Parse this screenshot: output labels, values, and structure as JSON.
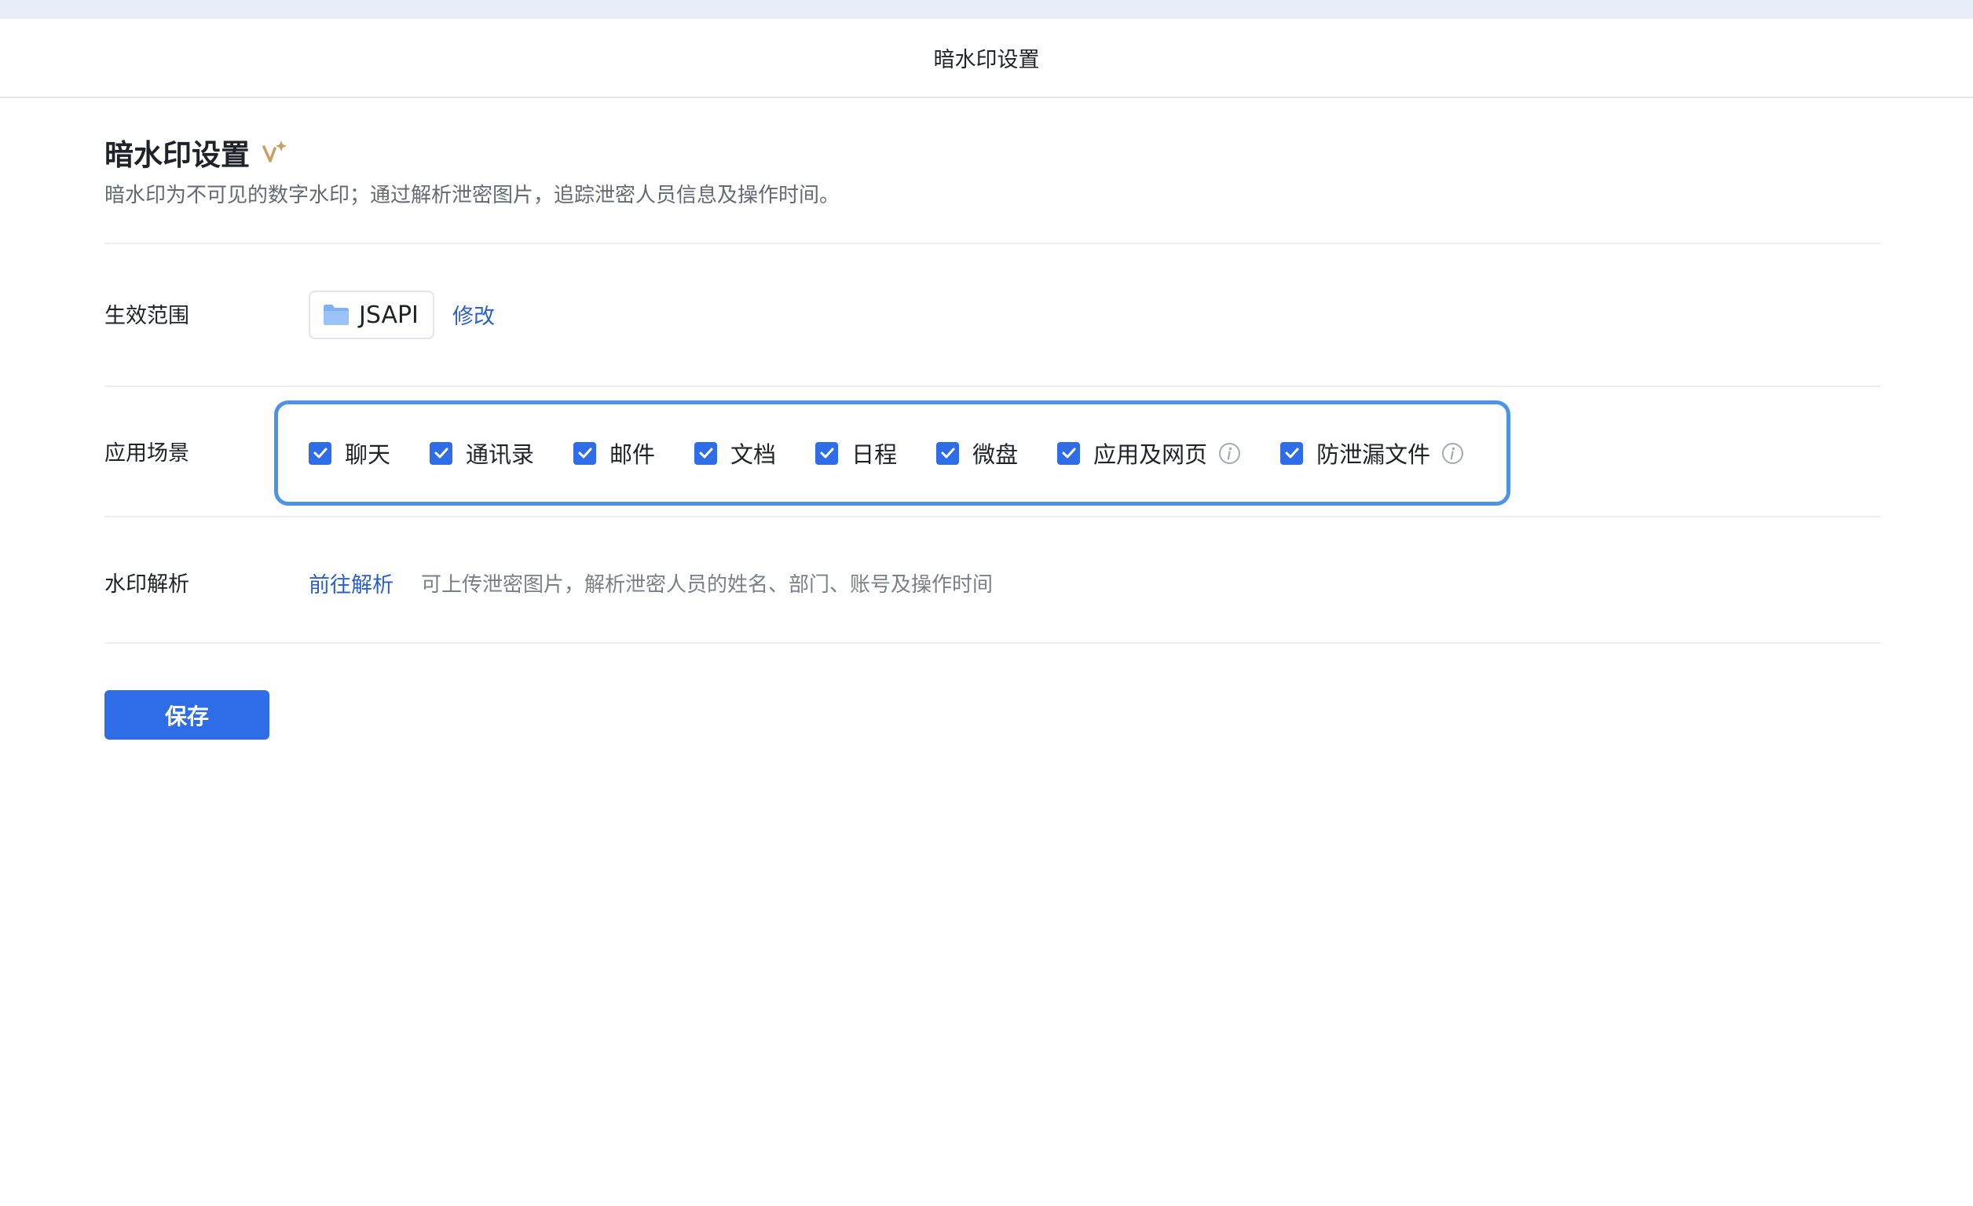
{
  "window": {
    "title": "暗水印设置"
  },
  "header": {
    "title": "暗水印设置",
    "description": "暗水印为不可见的数字水印；通过解析泄密图片，追踪泄密人员信息及操作时间。"
  },
  "scope": {
    "label": "生效范围",
    "value": "JSAPI",
    "icon": "folder-icon",
    "modify_label": "修改"
  },
  "scenes": {
    "label": "应用场景",
    "items": [
      {
        "label": "聊天",
        "checked": true,
        "info": false
      },
      {
        "label": "通讯录",
        "checked": true,
        "info": false
      },
      {
        "label": "邮件",
        "checked": true,
        "info": false
      },
      {
        "label": "文档",
        "checked": true,
        "info": false
      },
      {
        "label": "日程",
        "checked": true,
        "info": false
      },
      {
        "label": "微盘",
        "checked": true,
        "info": false
      },
      {
        "label": "应用及网页",
        "checked": true,
        "info": true
      },
      {
        "label": "防泄漏文件",
        "checked": true,
        "info": true
      }
    ]
  },
  "analysis": {
    "label": "水印解析",
    "link_label": "前往解析",
    "description": "可上传泄密图片，解析泄密人员的姓名、部门、账号及操作时间"
  },
  "actions": {
    "save_label": "保存"
  },
  "colors": {
    "accent": "#2f6de8",
    "link": "#2b60c6",
    "highlight_border": "#4b93e8",
    "muted_text": "#646a73"
  }
}
